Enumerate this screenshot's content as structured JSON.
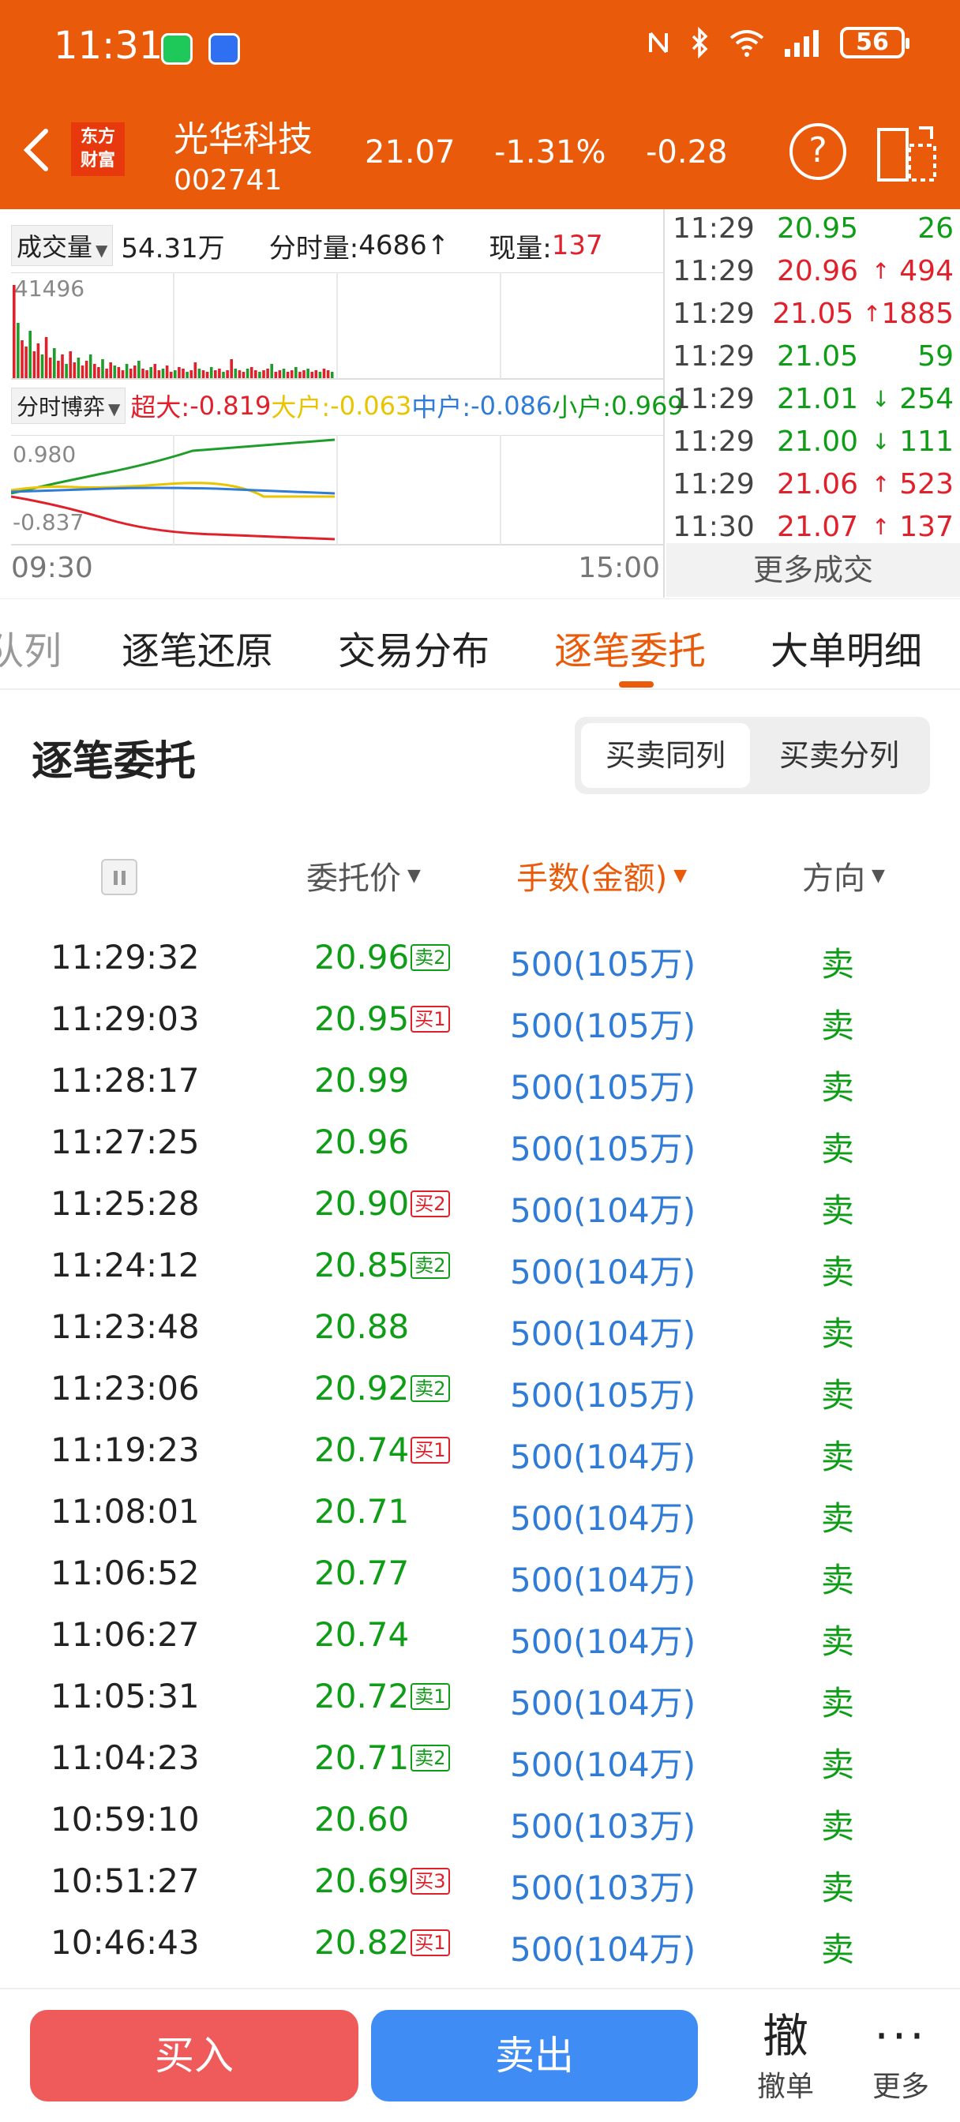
{
  "status": {
    "time": "11:31",
    "battery": "56"
  },
  "header": {
    "logo_line1": "东方",
    "logo_line2": "财富",
    "name": "光华科技",
    "code": "002741",
    "price": "21.07",
    "pct": "-1.31%",
    "change": "-0.28",
    "help": "?"
  },
  "chart": {
    "vol_selector": "成交量",
    "vol_value": "54.31万",
    "minute_vol_label": "分时量:",
    "minute_vol_value": "4686↑",
    "now_vol_label": "现量:",
    "now_vol_value": "137",
    "vol_max": "41496",
    "game_selector": "分时博弈",
    "xl_label": "超大:",
    "xl_value": "-0.819",
    "l_label": "大户:",
    "l_value": "-0.063",
    "m_label": "中户:",
    "m_value": "-0.086",
    "s_label": "小户:",
    "s_value": "0.969",
    "flow_max": "0.980",
    "flow_min": "-0.837",
    "time_start": "09:30",
    "time_end": "15:00"
  },
  "ticks": [
    {
      "time": "11:29",
      "price": "20.95",
      "arrow": "",
      "vol": "26",
      "color": "green"
    },
    {
      "time": "11:29",
      "price": "20.96",
      "arrow": "↑",
      "vol": "494",
      "color": "red"
    },
    {
      "time": "11:29",
      "price": "21.05",
      "arrow": "↑",
      "vol": "1885",
      "color": "red"
    },
    {
      "time": "11:29",
      "price": "21.05",
      "arrow": "",
      "vol": "59",
      "color": "green"
    },
    {
      "time": "11:29",
      "price": "21.01",
      "arrow": "↓",
      "vol": "254",
      "color": "green"
    },
    {
      "time": "11:29",
      "price": "21.00",
      "arrow": "↓",
      "vol": "111",
      "color": "green"
    },
    {
      "time": "11:29",
      "price": "21.06",
      "arrow": "↑",
      "vol": "523",
      "color": "red"
    },
    {
      "time": "11:30",
      "price": "21.07",
      "arrow": "↑",
      "vol": "137",
      "color": "red"
    }
  ],
  "more_trades": "更多成交",
  "tabs": [
    {
      "label": "队列",
      "state": "cut"
    },
    {
      "label": "逐笔还原",
      "state": ""
    },
    {
      "label": "交易分布",
      "state": ""
    },
    {
      "label": "逐笔委托",
      "state": "active"
    },
    {
      "label": "大单明细",
      "state": ""
    }
  ],
  "section": {
    "title": "逐笔委托",
    "seg_same": "买卖同列",
    "seg_split": "买卖分列"
  },
  "columns": {
    "price": "委托价",
    "volume": "手数(金额)",
    "direction": "方向"
  },
  "orders": [
    {
      "time": "11:29:32",
      "price": "20.96",
      "badge": "卖2",
      "badge_type": "sell",
      "vol": "500(105万)",
      "dir": "卖"
    },
    {
      "time": "11:29:03",
      "price": "20.95",
      "badge": "买1",
      "badge_type": "buy",
      "vol": "500(105万)",
      "dir": "卖"
    },
    {
      "time": "11:28:17",
      "price": "20.99",
      "badge": "",
      "badge_type": "",
      "vol": "500(105万)",
      "dir": "卖"
    },
    {
      "time": "11:27:25",
      "price": "20.96",
      "badge": "",
      "badge_type": "",
      "vol": "500(105万)",
      "dir": "卖"
    },
    {
      "time": "11:25:28",
      "price": "20.90",
      "badge": "买2",
      "badge_type": "buy",
      "vol": "500(104万)",
      "dir": "卖"
    },
    {
      "time": "11:24:12",
      "price": "20.85",
      "badge": "卖2",
      "badge_type": "sell",
      "vol": "500(104万)",
      "dir": "卖"
    },
    {
      "time": "11:23:48",
      "price": "20.88",
      "badge": "",
      "badge_type": "",
      "vol": "500(104万)",
      "dir": "卖"
    },
    {
      "time": "11:23:06",
      "price": "20.92",
      "badge": "卖2",
      "badge_type": "sell",
      "vol": "500(105万)",
      "dir": "卖"
    },
    {
      "time": "11:19:23",
      "price": "20.74",
      "badge": "买1",
      "badge_type": "buy",
      "vol": "500(104万)",
      "dir": "卖"
    },
    {
      "time": "11:08:01",
      "price": "20.71",
      "badge": "",
      "badge_type": "",
      "vol": "500(104万)",
      "dir": "卖"
    },
    {
      "time": "11:06:52",
      "price": "20.77",
      "badge": "",
      "badge_type": "",
      "vol": "500(104万)",
      "dir": "卖"
    },
    {
      "time": "11:06:27",
      "price": "20.74",
      "badge": "",
      "badge_type": "",
      "vol": "500(104万)",
      "dir": "卖"
    },
    {
      "time": "11:05:31",
      "price": "20.72",
      "badge": "卖1",
      "badge_type": "sell",
      "vol": "500(104万)",
      "dir": "卖"
    },
    {
      "time": "11:04:23",
      "price": "20.71",
      "badge": "卖2",
      "badge_type": "sell",
      "vol": "500(104万)",
      "dir": "卖"
    },
    {
      "time": "10:59:10",
      "price": "20.60",
      "badge": "",
      "badge_type": "",
      "vol": "500(103万)",
      "dir": "卖"
    },
    {
      "time": "10:51:27",
      "price": "20.69",
      "badge": "买3",
      "badge_type": "buy",
      "vol": "500(103万)",
      "dir": "卖"
    },
    {
      "time": "10:46:43",
      "price": "20.82",
      "badge": "买1",
      "badge_type": "buy",
      "vol": "500(104万)",
      "dir": "卖"
    }
  ],
  "bottom": {
    "buy": "买入",
    "sell": "卖出",
    "cancel_glyph": "撤",
    "cancel_label": "撤单",
    "more_label": "更多"
  }
}
